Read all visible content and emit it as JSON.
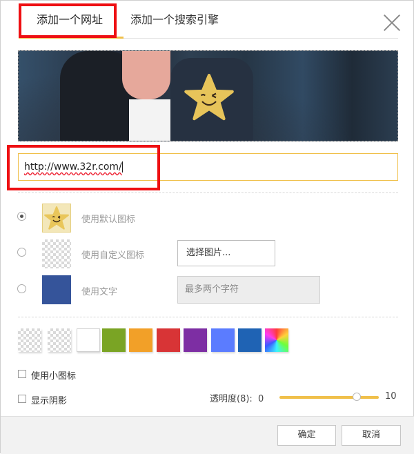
{
  "tabs": [
    {
      "label": "添加一个网址",
      "active": true
    },
    {
      "label": "添加一个搜索引擎",
      "active": false
    }
  ],
  "url": {
    "value": "http://www.32r.com/"
  },
  "icon_options": [
    {
      "label": "使用默认图标",
      "checked": true
    },
    {
      "label": "使用自定义图标",
      "checked": false,
      "button_label": "选择图片..."
    },
    {
      "label": "使用文字",
      "checked": false,
      "placeholder": "最多两个字符"
    }
  ],
  "colors": {
    "accent": "#f0c04a",
    "swatches": [
      "transparent",
      "transparent",
      "#ffffff",
      "#7aa424",
      "#f2a028",
      "#d83436",
      "#7d2ea3",
      "#5b7cff",
      "#1f63b4",
      "rainbow"
    ],
    "text_icon_bg": "#35549a"
  },
  "checkboxes": [
    {
      "label": "使用小图标",
      "checked": false
    },
    {
      "label": "显示阴影",
      "checked": false
    }
  ],
  "opacity": {
    "label": "透明度(8):",
    "min": "0",
    "max": "10",
    "value": 8
  },
  "footer": {
    "ok": "确定",
    "cancel": "取消"
  },
  "icons": {
    "close": "close-icon",
    "star": "star-smile-icon"
  }
}
